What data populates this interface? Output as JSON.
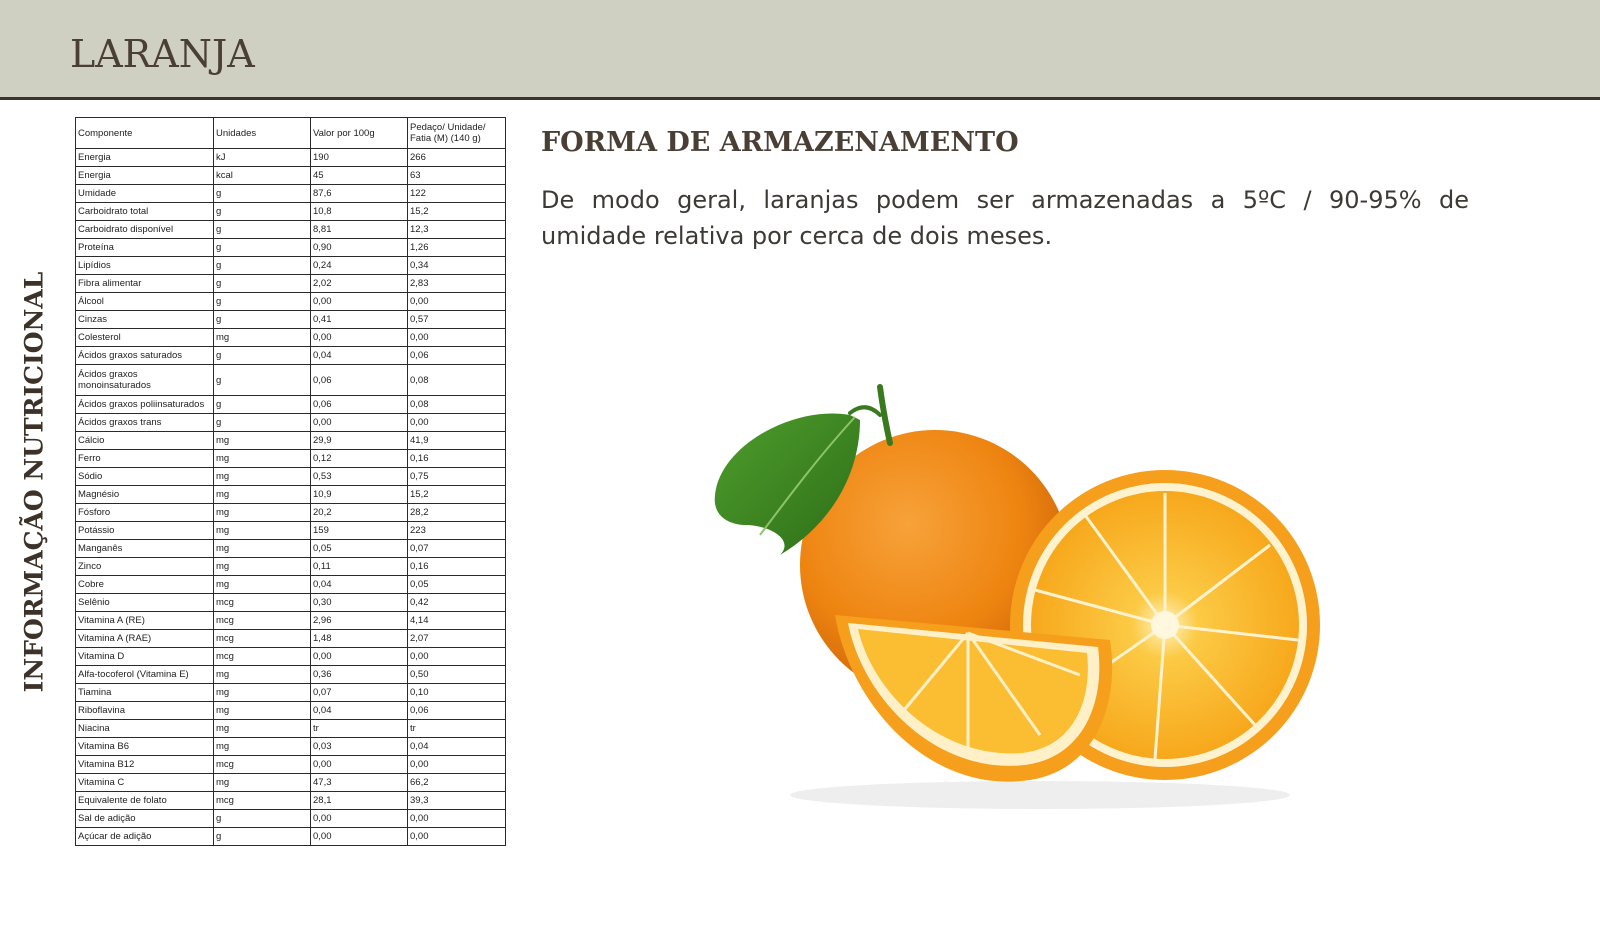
{
  "header": {
    "title": "LARANJA"
  },
  "side_label": "INFORMAÇÃO NUTRICIONAL",
  "storage": {
    "title": "FORMA DE ARMAZENAMENTO",
    "text": "De modo geral, laranjas podem ser armazenadas a 5ºC / 90-95% de umidade relativa por cerca de dois meses."
  },
  "table": {
    "headers": [
      "Componente",
      "Unidades",
      "Valor por 100g",
      "Pedaço/ Unidade/ Fatia (M) (140 g)"
    ],
    "rows": [
      [
        "Energia",
        "kJ",
        "190",
        "266"
      ],
      [
        "Energia",
        "kcal",
        "45",
        "63"
      ],
      [
        "Umidade",
        "g",
        "87,6",
        "122"
      ],
      [
        "Carboidrato total",
        "g",
        "10,8",
        "15,2"
      ],
      [
        "Carboidrato disponível",
        "g",
        "8,81",
        "12,3"
      ],
      [
        "Proteína",
        "g",
        "0,90",
        "1,26"
      ],
      [
        "Lipídios",
        "g",
        "0,24",
        "0,34"
      ],
      [
        "Fibra alimentar",
        "g",
        "2,02",
        "2,83"
      ],
      [
        "Álcool",
        "g",
        "0,00",
        "0,00"
      ],
      [
        "Cinzas",
        "g",
        "0,41",
        "0,57"
      ],
      [
        "Colesterol",
        "mg",
        "0,00",
        "0,00"
      ],
      [
        "Ácidos graxos saturados",
        "g",
        "0,04",
        "0,06"
      ],
      [
        "Ácidos graxos monoinsaturados",
        "g",
        "0,06",
        "0,08"
      ],
      [
        "Ácidos graxos poliinsaturados",
        "g",
        "0,06",
        "0,08"
      ],
      [
        "Ácidos graxos trans",
        "g",
        "0,00",
        "0,00"
      ],
      [
        "Cálcio",
        "mg",
        "29,9",
        "41,9"
      ],
      [
        "Ferro",
        "mg",
        "0,12",
        "0,16"
      ],
      [
        "Sódio",
        "mg",
        "0,53",
        "0,75"
      ],
      [
        "Magnésio",
        "mg",
        "10,9",
        "15,2"
      ],
      [
        "Fósforo",
        "mg",
        "20,2",
        "28,2"
      ],
      [
        "Potássio",
        "mg",
        "159",
        "223"
      ],
      [
        "Manganês",
        "mg",
        "0,05",
        "0,07"
      ],
      [
        "Zinco",
        "mg",
        "0,11",
        "0,16"
      ],
      [
        "Cobre",
        "mg",
        "0,04",
        "0,05"
      ],
      [
        "Selênio",
        "mcg",
        "0,30",
        "0,42"
      ],
      [
        "Vitamina A (RE)",
        "mcg",
        "2,96",
        "4,14"
      ],
      [
        "Vitamina A (RAE)",
        "mcg",
        "1,48",
        "2,07"
      ],
      [
        "Vitamina D",
        "mcg",
        "0,00",
        "0,00"
      ],
      [
        "Alfa-tocoferol (Vitamina E)",
        "mg",
        "0,36",
        "0,50"
      ],
      [
        "Tiamina",
        "mg",
        "0,07",
        "0,10"
      ],
      [
        "Riboflavina",
        "mg",
        "0,04",
        "0,06"
      ],
      [
        "Niacina",
        "mg",
        "tr",
        "tr"
      ],
      [
        "Vitamina B6",
        "mg",
        "0,03",
        "0,04"
      ],
      [
        "Vitamina B12",
        "mcg",
        "0,00",
        "0,00"
      ],
      [
        "Vitamina C",
        "mg",
        "47,3",
        "66,2"
      ],
      [
        "Equivalente de folato",
        "mcg",
        "28,1",
        "39,3"
      ],
      [
        "Sal de adição",
        "g",
        "0,00",
        "0,00"
      ],
      [
        "Açúcar de adição",
        "g",
        "0,00",
        "0,00"
      ]
    ]
  },
  "colors": {
    "header_bg": "#cfd0c1",
    "title_text": "#4a3f35",
    "orange_peel": "#f08a12",
    "orange_flesh": "#fbb427",
    "leaf": "#3f8a22"
  },
  "image": {
    "subject": "oranges"
  }
}
